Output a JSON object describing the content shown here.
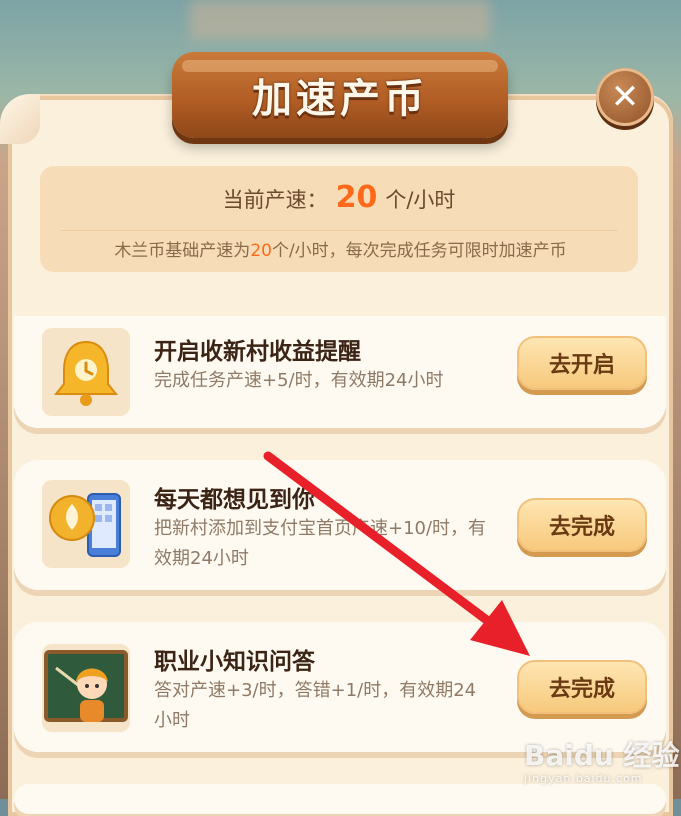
{
  "modal": {
    "title": "加速产币",
    "close_label": "✕"
  },
  "rate": {
    "label": "当前产速：",
    "value": "20",
    "unit": "个/小时",
    "note_prefix": "木兰币基础产速为",
    "note_value": "20",
    "note_suffix": "个/小时，每次完成任务可限时加速产币"
  },
  "tasks": [
    {
      "title": "开启收新村收益提醒",
      "desc": "完成任务产速+5/时，有效期24小时",
      "button": "去开启",
      "icon": "bell-icon"
    },
    {
      "title": "每天都想见到你",
      "desc": "把新村添加到支付宝首页产速+10/时，有效期24小时",
      "button": "去完成",
      "icon": "phone-icon"
    },
    {
      "title": "职业小知识问答",
      "desc": "答对产速+3/时，答错+1/时，有效期24小时",
      "button": "去完成",
      "icon": "teacher-icon"
    }
  ],
  "watermark": {
    "brand": "Baidu 经验",
    "url": "jingyan.baidu.com"
  },
  "colors": {
    "accent": "#ff6a1a",
    "panel": "#fbf0dc",
    "button": "#f7c97c",
    "arrow": "#e8202a"
  }
}
